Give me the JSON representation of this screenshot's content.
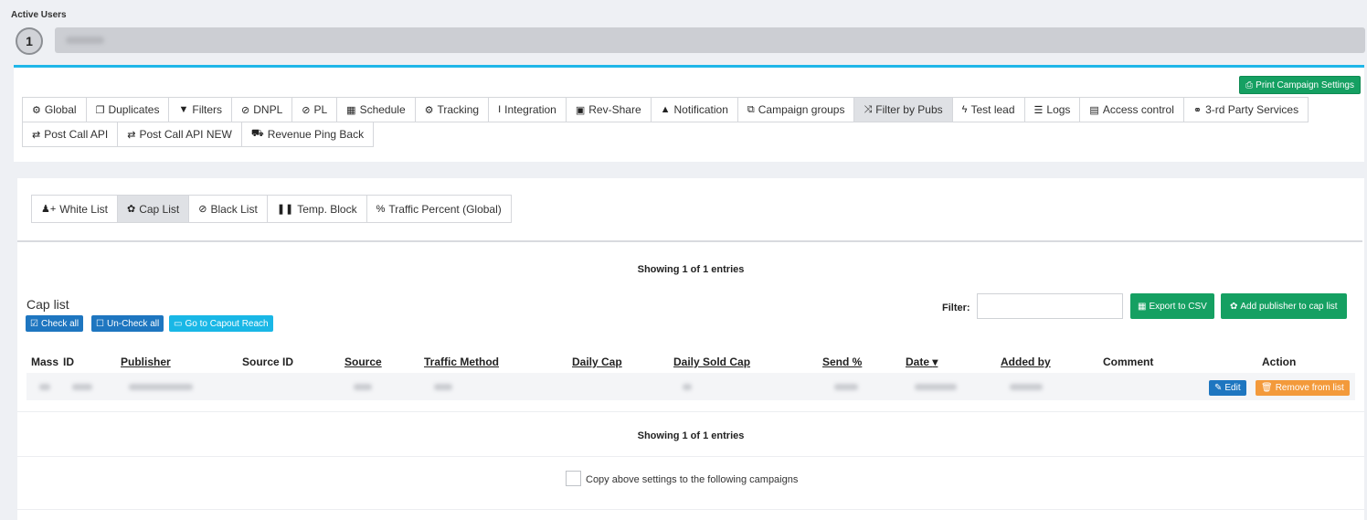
{
  "active_users": {
    "label": "Active Users",
    "count": "1"
  },
  "print_button": {
    "label": "Print Campaign Settings"
  },
  "main_tabs": [
    {
      "label": "Global",
      "icon": "gears-icon",
      "glyph": "⚙"
    },
    {
      "label": "Duplicates",
      "icon": "copy-icon",
      "glyph": "❐"
    },
    {
      "label": "Filters",
      "icon": "filter-icon",
      "glyph": "▼"
    },
    {
      "label": "DNPL",
      "icon": "ban-icon",
      "glyph": "⊘"
    },
    {
      "label": "PL",
      "icon": "ban-icon",
      "glyph": "⊘"
    },
    {
      "label": "Schedule",
      "icon": "calendar-icon",
      "glyph": "▦"
    },
    {
      "label": "Tracking",
      "icon": "gears-icon",
      "glyph": "⚙"
    },
    {
      "label": "Integration",
      "icon": "text-cursor-icon",
      "glyph": "I"
    },
    {
      "label": "Rev-Share",
      "icon": "money-icon",
      "glyph": "▣"
    },
    {
      "label": "Notification",
      "icon": "bell-icon",
      "glyph": "▲"
    },
    {
      "label": "Campaign groups",
      "icon": "object-group-icon",
      "glyph": "⧉"
    },
    {
      "label": "Filter by Pubs",
      "icon": "random-icon",
      "glyph": "⤨",
      "active": true
    },
    {
      "label": "Test lead",
      "icon": "bolt-icon",
      "glyph": "ϟ"
    },
    {
      "label": "Logs",
      "icon": "list-icon",
      "glyph": "☰"
    },
    {
      "label": "Access control",
      "icon": "file-icon",
      "glyph": "▤"
    },
    {
      "label": "3-rd Party Services",
      "icon": "handshake-icon",
      "glyph": "⚭"
    },
    {
      "label": "Post Call API",
      "icon": "exchange-icon",
      "glyph": "⇄"
    },
    {
      "label": "Post Call API NEW",
      "icon": "exchange-icon",
      "glyph": "⇄"
    },
    {
      "label": "Revenue Ping Back",
      "icon": "cart-icon",
      "glyph": "⛟"
    }
  ],
  "sub_tabs": [
    {
      "label": "White List",
      "icon": "user-plus-icon",
      "glyph": "♟+"
    },
    {
      "label": "Cap List",
      "icon": "gear-icon",
      "glyph": "✿",
      "active": true
    },
    {
      "label": "Black List",
      "icon": "ban-icon",
      "glyph": "⊘"
    },
    {
      "label": "Temp. Block",
      "icon": "pause-icon",
      "glyph": "❚❚"
    },
    {
      "label": "Traffic Percent (Global)",
      "icon": "percent-icon",
      "glyph": "%"
    }
  ],
  "showing_top": "Showing 1 of 1 entries",
  "showing_bottom": "Showing 1 of 1 entries",
  "cap_list": {
    "title": "Cap list",
    "check_all": "Check all",
    "uncheck_all": "Un-Check all",
    "goto_reach": "Go to Capout Reach",
    "filter_label": "Filter:",
    "filter_value": "",
    "export_csv": "Export to CSV",
    "add_publisher": "Add publisher to cap list"
  },
  "table": {
    "headers": {
      "mass": "Mass",
      "id": "ID",
      "publisher": "Publisher",
      "source_id": "Source ID",
      "source": "Source",
      "traffic_method": "Traffic Method",
      "daily_cap": "Daily Cap",
      "daily_sold_cap": "Daily Sold Cap",
      "send_pct": "Send %",
      "date": "Date",
      "date_sort": "▾",
      "added_by": "Added by",
      "comment": "Comment",
      "action": "Action"
    },
    "row_actions": {
      "edit": "Edit",
      "remove": "Remove from list"
    }
  },
  "copy_settings": {
    "label": "Copy above settings to the following campaigns"
  }
}
